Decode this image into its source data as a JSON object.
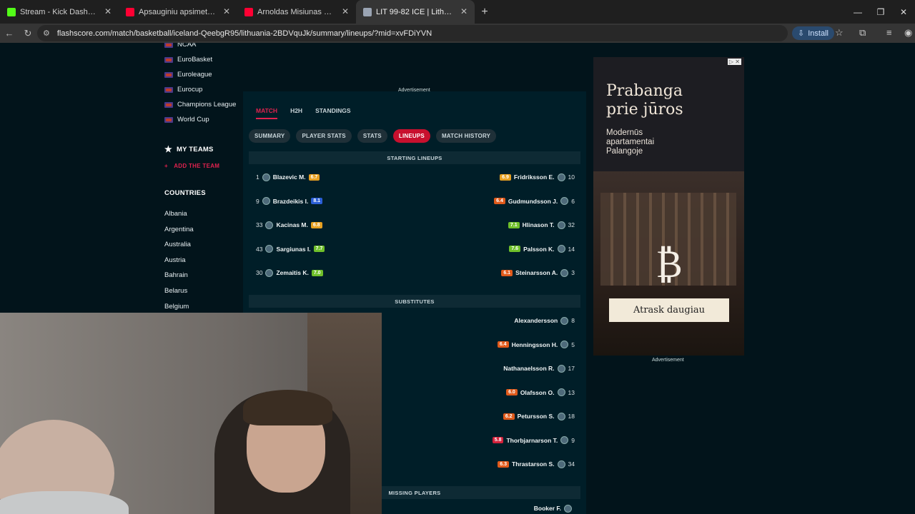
{
  "browser": {
    "tabs": [
      {
        "title": "Stream - Kick Dashboard",
        "color": "#53fc18",
        "active": false
      },
      {
        "title": "Apsauginiu apsimetęs vyras pa",
        "color": "#ff0033",
        "active": false
      },
      {
        "title": "Arnoldas Misiunas Vs Egidijus D",
        "color": "#ff0033",
        "active": false
      },
      {
        "title": "LIT 99-82 ICE | Lithuania v Icela",
        "color": "#9aa4b3",
        "active": true
      }
    ],
    "url": "flashscore.com/match/basketball/iceland-QeebgR95/lithuania-2BDVquJk/summary/lineups/?mid=xvFDiYVN",
    "install_label": "Install"
  },
  "leftnav": {
    "leagues": [
      "NCAA",
      "EuroBasket",
      "Euroleague",
      "Eurocup",
      "Champions League",
      "World Cup"
    ],
    "my_teams": "MY TEAMS",
    "add_team": "ADD THE TEAM",
    "countries_title": "COUNTRIES",
    "countries": [
      "Albania",
      "Argentina",
      "Australia",
      "Austria",
      "Bahrain",
      "Belarus",
      "Belgium"
    ]
  },
  "main": {
    "ad_label": "Advertisement",
    "top_tabs": [
      "MATCH",
      "H2H",
      "STANDINGS"
    ],
    "pills": [
      "SUMMARY",
      "PLAYER STATS",
      "STATS",
      "LINEUPS",
      "MATCH HISTORY"
    ],
    "starting_title": "STARTING LINEUPS",
    "substitutes_title": "SUBSTITUTES",
    "missing_title": "MISSING PLAYERS",
    "home_starters": [
      {
        "num": "1",
        "name": "Blazevic M.",
        "rating": "6.7",
        "rc": "r-or"
      },
      {
        "num": "9",
        "name": "Brazdeikis I.",
        "rating": "8.1",
        "rc": "r-blue"
      },
      {
        "num": "33",
        "name": "Kacinas M.",
        "rating": "6.8",
        "rc": "r-or"
      },
      {
        "num": "43",
        "name": "Sargiunas I.",
        "rating": "7.7",
        "rc": "r-green"
      },
      {
        "num": "30",
        "name": "Zemaitis K.",
        "rating": "7.0",
        "rc": "r-green"
      }
    ],
    "away_starters": [
      {
        "num": "10",
        "name": "Fridriksson E.",
        "rating": "6.9",
        "rc": "r-or"
      },
      {
        "num": "6",
        "name": "Gudmundsson J.",
        "rating": "6.4",
        "rc": "r-red"
      },
      {
        "num": "32",
        "name": "Hlinason T.",
        "rating": "7.1",
        "rc": "r-green"
      },
      {
        "num": "14",
        "name": "Palsson K.",
        "rating": "7.6",
        "rc": "r-green"
      },
      {
        "num": "3",
        "name": "Steinarsson A.",
        "rating": "6.1",
        "rc": "r-red"
      }
    ],
    "away_subs": [
      {
        "num": "8",
        "name": "Alexandersson",
        "rating": "",
        "rc": ""
      },
      {
        "num": "5",
        "name": "Henningsson H.",
        "rating": "6.4",
        "rc": "r-red"
      },
      {
        "num": "17",
        "name": "Nathanaelsson R.",
        "rating": "",
        "rc": ""
      },
      {
        "num": "13",
        "name": "Olafsson O.",
        "rating": "6.0",
        "rc": "r-red"
      },
      {
        "num": "18",
        "name": "Petursson S.",
        "rating": "6.2",
        "rc": "r-red"
      },
      {
        "num": "9",
        "name": "Thorbjarnarson T.",
        "rating": "5.8",
        "rc": "r-crimson"
      },
      {
        "num": "34",
        "name": "Thrastarson S.",
        "rating": "6.3",
        "rc": "r-red"
      }
    ],
    "away_missing": [
      {
        "num": "",
        "name": "Booker F.",
        "rating": "",
        "rc": ""
      }
    ]
  },
  "ad": {
    "headline_1": "Prabanga",
    "headline_2": "prie jūros",
    "sub_1": "Modernūs",
    "sub_2": "apartamentai",
    "sub_3": "Palangoje",
    "cta": "Atrask daugiau",
    "label": "Advertisement"
  }
}
